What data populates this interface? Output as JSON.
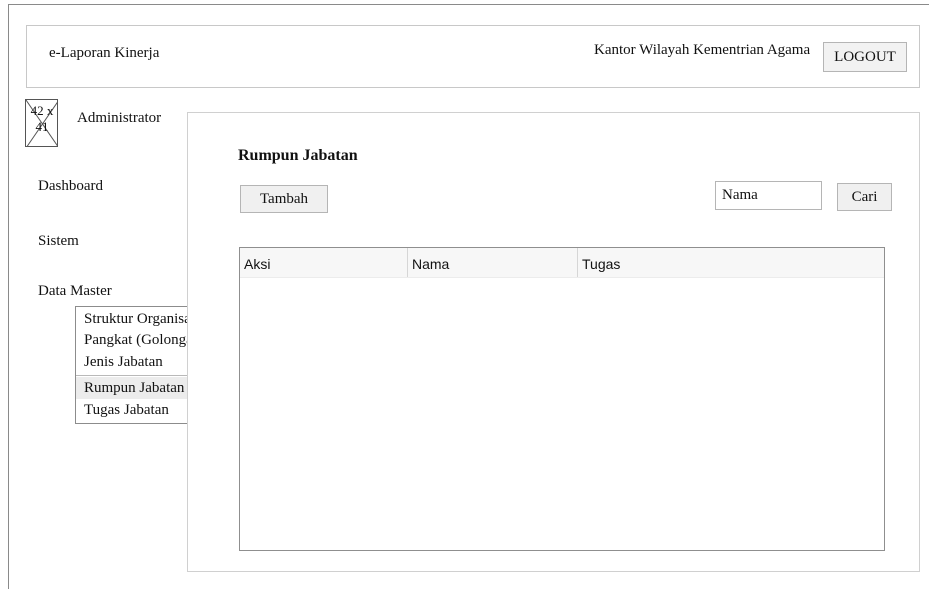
{
  "header": {
    "app_title": "e-Laporan Kinerja",
    "org_name": "Kantor Wilayah Kementrian Agama",
    "logout_label": "LOGOUT"
  },
  "user": {
    "avatar_placeholder": "42 x\n41",
    "avatar_icon": "image-placeholder-icon",
    "role": "Administrator"
  },
  "sidebar": {
    "items": [
      {
        "label": "Dashboard"
      },
      {
        "label": "Sistem"
      },
      {
        "label": "Data Master"
      }
    ],
    "submenu": [
      {
        "label": "Struktur Organisasi",
        "active": false
      },
      {
        "label": "Pangkat (Golongan)",
        "active": false
      },
      {
        "label": "Jenis Jabatan",
        "active": false
      },
      {
        "label": "Rumpun Jabatan",
        "active": true
      },
      {
        "label": "Tugas Jabatan",
        "active": false
      }
    ]
  },
  "main": {
    "title": "Rumpun Jabatan",
    "add_label": "Tambah",
    "search": {
      "value": "Nama"
    },
    "search_button_label": "Cari",
    "table": {
      "columns": [
        "Aksi",
        "Nama",
        "Tugas"
      ],
      "rows": []
    }
  }
}
